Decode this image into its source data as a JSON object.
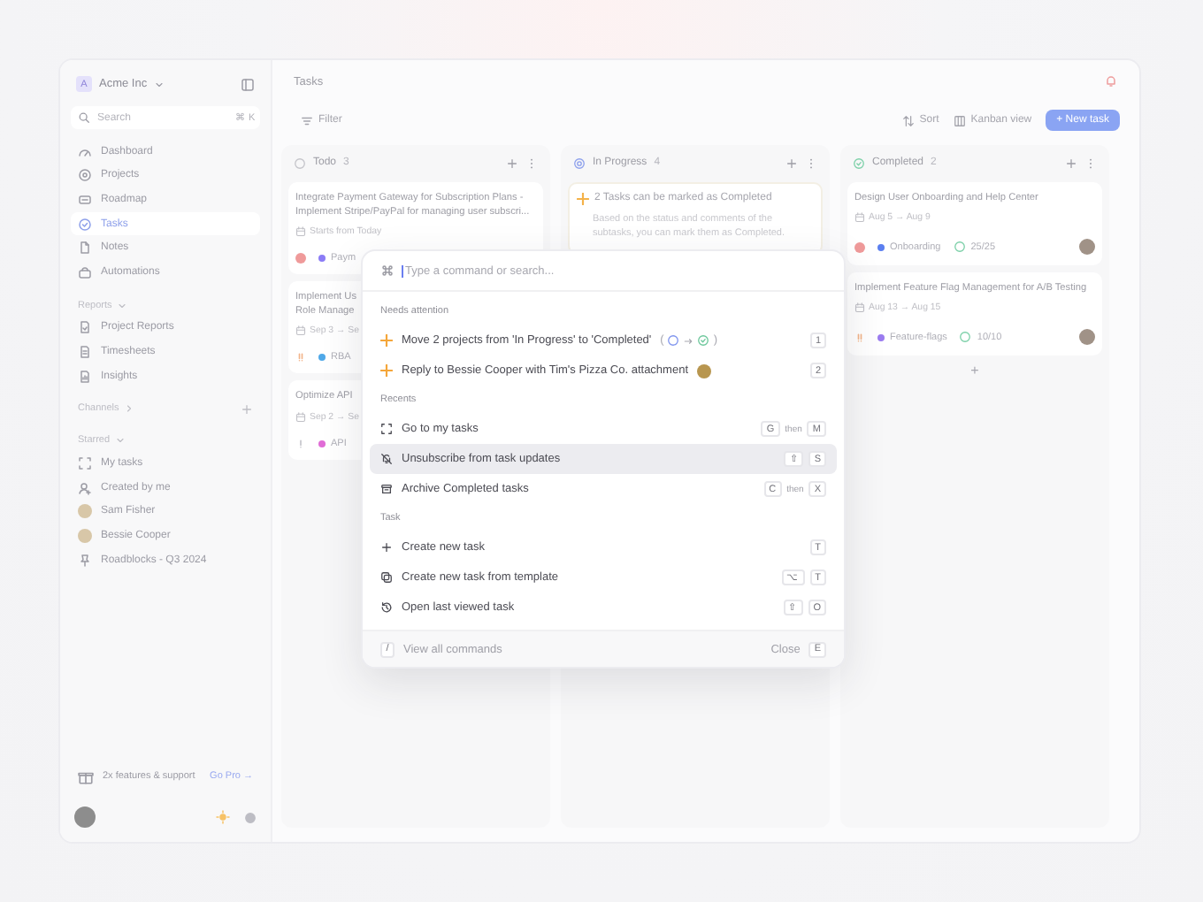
{
  "sidebar": {
    "workspace": {
      "initial": "A",
      "name": "Acme Inc"
    },
    "search": {
      "placeholder": "Search",
      "shortcut": "⌘ K"
    },
    "nav": [
      {
        "label": "Dashboard",
        "selected": false
      },
      {
        "label": "Projects",
        "selected": false
      },
      {
        "label": "Roadmap",
        "selected": false
      },
      {
        "label": "Tasks",
        "selected": true
      },
      {
        "label": "Notes",
        "selected": false
      },
      {
        "label": "Automations",
        "selected": false
      }
    ],
    "sections": [
      {
        "title": "Reports",
        "kind": "list",
        "items": [
          {
            "label": "Project Reports",
            "kind": "report"
          },
          {
            "label": "Timesheets",
            "kind": "sheet"
          },
          {
            "label": "Insights",
            "kind": "insight"
          }
        ]
      },
      {
        "title": "Channels",
        "kind": "collapsed"
      },
      {
        "title": "Starred",
        "kind": "list",
        "items": [
          {
            "label": "My tasks",
            "kind": "focus"
          },
          {
            "label": "Created by me",
            "kind": "user"
          },
          {
            "label": "Sam Fisher",
            "kind": "person"
          },
          {
            "label": "Bessie Cooper",
            "kind": "person"
          },
          {
            "label": "Roadblocks - Q3 2024",
            "kind": "pin"
          }
        ]
      }
    ],
    "promo": {
      "text": "2x features & support",
      "link": "Go Pro →"
    }
  },
  "header": {
    "title": "Tasks"
  },
  "toolbar": {
    "filter": "Filter",
    "sort": "Sort",
    "view": "Kanban view",
    "new_task": "+ New task"
  },
  "columns": [
    {
      "title": "Todo",
      "count": "3",
      "kind": "todo",
      "cards": [
        {
          "kind": "task",
          "title_lines": [
            "Integrate Payment Gateway for Subscription Plans -",
            "Implement Stripe/PayPal for managing user subscri..."
          ],
          "date": "Starts from Today",
          "priority": {
            "kind": "urgent"
          },
          "tag": {
            "label": "Paym",
            "color": "#8b7cf6"
          }
        },
        {
          "kind": "task",
          "title_lines": [
            "Implement Us",
            "Role Manage"
          ],
          "date": "Sep 3 → Se",
          "priority": {
            "kind": "high"
          },
          "tag": {
            "label": "RBA",
            "color": "#4fa8e8"
          }
        },
        {
          "kind": "task",
          "title_lines": [
            "Optimize API"
          ],
          "date": "Sep 2 → Se",
          "priority": {
            "kind": "low"
          },
          "tag": {
            "label": "API",
            "color": "#e06cd6"
          }
        }
      ]
    },
    {
      "title": "In Progress",
      "count": "4",
      "kind": "in_progress",
      "cards": [
        {
          "kind": "suggestion",
          "title_lines": [
            "2 Tasks can be marked as Completed"
          ],
          "body": "Based on the status and comments of the subtasks, you can mark them as Completed."
        }
      ]
    },
    {
      "title": "Completed",
      "count": "2",
      "kind": "completed",
      "add": "+",
      "cards": [
        {
          "kind": "task",
          "title_lines": [
            "Design User Onboarding and Help Center"
          ],
          "date": "Aug 5 → Aug 9",
          "priority": {
            "kind": "urgent"
          },
          "tag": {
            "label": "Onboarding",
            "color": "#5b7ff0"
          },
          "progress": "25/25",
          "avatar": true
        },
        {
          "kind": "task",
          "title_lines": [
            "Implement Feature Flag Management for A/B Testing"
          ],
          "date": "Aug 13 → Aug 15",
          "priority": {
            "kind": "high"
          },
          "tag": {
            "label": "Feature-flags",
            "color": "#9b7cf0"
          },
          "progress": "10/10",
          "avatar": true
        }
      ]
    }
  ],
  "palette": {
    "placeholder": "Type a command or search...",
    "groups": [
      {
        "title": "Needs attention",
        "items": [
          {
            "label": "Move 2 projects from 'In Progress' to 'Completed'",
            "kind": "suggestion",
            "selected": false,
            "transition": {
              "open": "(",
              "close": ")"
            },
            "keys": [
              "1"
            ]
          },
          {
            "label": "Reply to Bessie Cooper with Tim's Pizza Co. attachment",
            "kind": "suggestion",
            "selected": false,
            "avatar": true,
            "keys": [
              "2"
            ]
          }
        ]
      },
      {
        "title": "Recents",
        "items": [
          {
            "label": "Go to my tasks",
            "kind": "focus",
            "selected": false,
            "keys": [
              "G",
              "M"
            ],
            "joiner": "then"
          },
          {
            "label": "Unsubscribe from task updates",
            "kind": "bell_off",
            "selected": true,
            "keys": [
              "⇧",
              "S"
            ]
          },
          {
            "label": "Archive Completed tasks",
            "kind": "archive",
            "selected": false,
            "keys": [
              "C",
              "X"
            ],
            "joiner": "then"
          }
        ]
      },
      {
        "title": "Task",
        "items": [
          {
            "label": "Create new task",
            "kind": "plus",
            "selected": false,
            "keys": [
              "T"
            ]
          },
          {
            "label": "Create new task from template",
            "kind": "template",
            "selected": false,
            "keys": [
              "⌥",
              "T"
            ]
          },
          {
            "label": "Open last viewed task",
            "kind": "history",
            "selected": false,
            "keys": [
              "⇧",
              "O"
            ]
          }
        ]
      }
    ],
    "footer": {
      "key": "/",
      "label": "View all commands",
      "close": "Close",
      "close_key": "E"
    }
  }
}
